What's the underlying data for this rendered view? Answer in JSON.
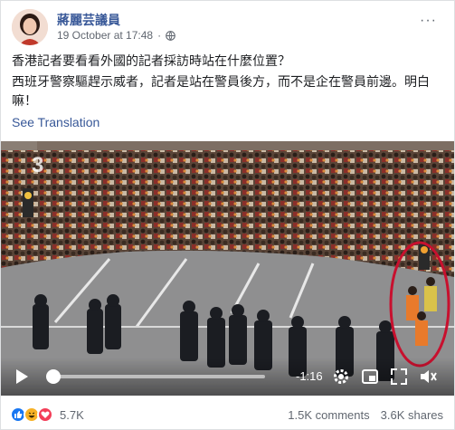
{
  "header": {
    "page_name": "蔣麗芸議員",
    "timestamp": "19 October at 17:48",
    "separator": "·",
    "privacy_icon": "globe-icon",
    "more_icon": "more-options-icon",
    "more_label": "···"
  },
  "post": {
    "line1": "香港記者要看看外國的記者採訪時站在什麼位置？",
    "line2": "西班牙警察驅趕示威者，記者是站在警員後方，而不是企在警員前邊。明白嘛！",
    "see_translation": "See Translation"
  },
  "video": {
    "time_remaining": "-1:16",
    "progress_fraction": 0.02,
    "watermark": "3",
    "controls": [
      "play-icon",
      "settings-gear-icon",
      "picture-in-picture-icon",
      "fullscreen-icon",
      "volume-icon"
    ]
  },
  "footer": {
    "reactions": [
      "like-icon",
      "haha-icon",
      "love-icon"
    ],
    "reaction_count": "5.7K",
    "comments": "1.5K comments",
    "shares": "3.6K shares"
  },
  "colors": {
    "link_blue": "#385898",
    "meta_gray": "#616770",
    "annotation_red": "#c8102e"
  }
}
